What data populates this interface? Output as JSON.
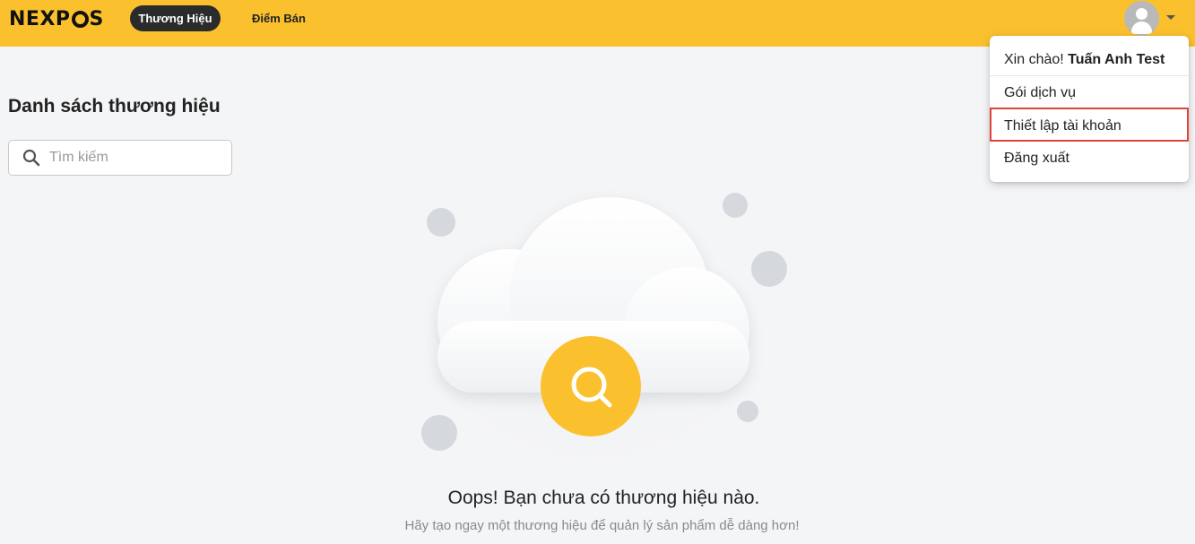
{
  "header": {
    "logo_text_left": "NEXP",
    "logo_text_right": "S",
    "tabs": [
      {
        "label": "Thương Hiệu",
        "active": true
      },
      {
        "label": "Điểm Bán",
        "active": false
      }
    ],
    "accent_color": "#fbc02d"
  },
  "page": {
    "title": "Danh sách thương hiệu",
    "search": {
      "placeholder": "Tìm kiếm",
      "value": ""
    }
  },
  "empty_state": {
    "title": "Oops! Bạn chưa có thương hiệu nào.",
    "subtitle": "Hãy tạo ngay một thương hiệu để quản lý sản phẩm dễ dàng hơn!"
  },
  "user_menu": {
    "greeting_prefix": "Xin chào!",
    "user_name": "Tuấn Anh Test",
    "items": [
      {
        "label": "Gói dịch vụ"
      },
      {
        "label": "Thiết lập tài khoản",
        "highlighted": true
      },
      {
        "label": "Đăng xuất"
      }
    ]
  }
}
